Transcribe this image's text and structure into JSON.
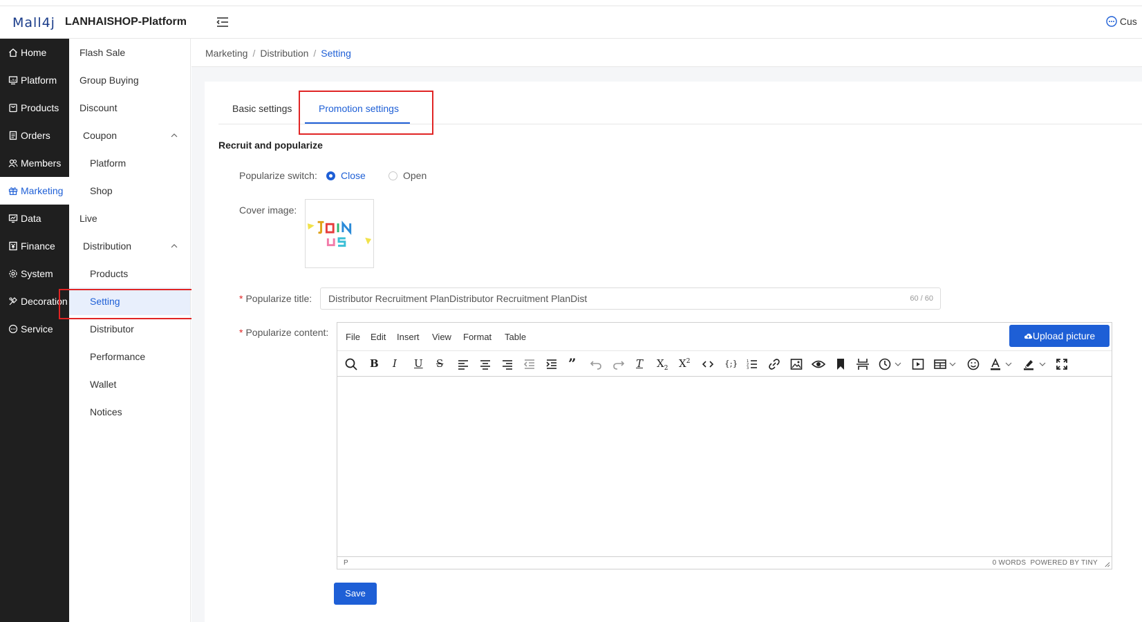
{
  "header": {
    "logo_text": "Mall4j",
    "brand": "LANHAISHOP-Platform",
    "service_label": "Cus"
  },
  "main_nav": {
    "items": [
      {
        "label": "Home",
        "icon": "home-icon"
      },
      {
        "label": "Platform",
        "icon": "monitor-icon"
      },
      {
        "label": "Products",
        "icon": "bag-icon"
      },
      {
        "label": "Orders",
        "icon": "document-icon"
      },
      {
        "label": "Members",
        "icon": "users-icon"
      },
      {
        "label": "Marketing",
        "icon": "gift-icon"
      },
      {
        "label": "Data",
        "icon": "chart-icon"
      },
      {
        "label": "Finance",
        "icon": "yen-icon"
      },
      {
        "label": "System",
        "icon": "gear-icon"
      },
      {
        "label": "Decoration",
        "icon": "palette-icon"
      },
      {
        "label": "Service",
        "icon": "chat-icon"
      }
    ],
    "active": "Marketing"
  },
  "sub_nav": {
    "items": [
      {
        "label": "Flash Sale"
      },
      {
        "label": "Group Buying"
      },
      {
        "label": "Discount"
      },
      {
        "label": "Coupon"
      },
      {
        "label": "Platform"
      },
      {
        "label": "Shop"
      },
      {
        "label": "Live"
      },
      {
        "label": "Distribution"
      },
      {
        "label": "Products"
      },
      {
        "label": "Setting"
      },
      {
        "label": "Distributor"
      },
      {
        "label": "Performance"
      },
      {
        "label": "Wallet"
      },
      {
        "label": "Notices"
      }
    ],
    "active": "Setting"
  },
  "breadcrumb": {
    "items": [
      "Marketing",
      "Distribution",
      "Setting"
    ]
  },
  "tabs": {
    "basic": "Basic settings",
    "promotion": "Promotion settings",
    "active": "Promotion settings"
  },
  "section": {
    "title": "Recruit and popularize"
  },
  "form": {
    "switch_label": "Popularize switch:",
    "switch_options": [
      "Close",
      "Open"
    ],
    "switch_selected": "Close",
    "cover_label": "Cover image:",
    "cover_image_text": "JOIN US",
    "title_label": "Popularize title:",
    "title_value": "Distributor Recruitment PlanDistributor Recruitment PlanDist",
    "title_counter": "60 / 60",
    "content_label": "Popularize content:"
  },
  "editor": {
    "menus": [
      "File",
      "Edit",
      "Insert",
      "View",
      "Format",
      "Table"
    ],
    "upload_label": "Upload picture",
    "status_path": "P",
    "status_words": "0 WORDS",
    "status_powered": "POWERED BY TINY",
    "toolbar_icons": [
      "search-icon",
      "bold-icon",
      "italic-icon",
      "underline-icon",
      "strikethrough-icon",
      "align-left-icon",
      "align-center-icon",
      "align-right-icon",
      "outdent-icon",
      "indent-icon",
      "blockquote-icon",
      "undo-icon",
      "redo-icon",
      "clear-format-icon",
      "subscript-icon",
      "superscript-icon",
      "code-icon",
      "code-sample-icon",
      "numbered-list-icon",
      "link-icon",
      "image-icon",
      "preview-icon",
      "bookmark-icon",
      "page-break-icon",
      "clock-icon",
      "media-icon",
      "table-icon",
      "emoji-icon",
      "font-color-icon",
      "highlight-icon",
      "fullscreen-icon"
    ]
  },
  "actions": {
    "save_label": "Save"
  },
  "colors": {
    "accent": "#1e5fd6",
    "sidebar_bg": "#1f1f1f",
    "highlight_box": "#e02424"
  }
}
